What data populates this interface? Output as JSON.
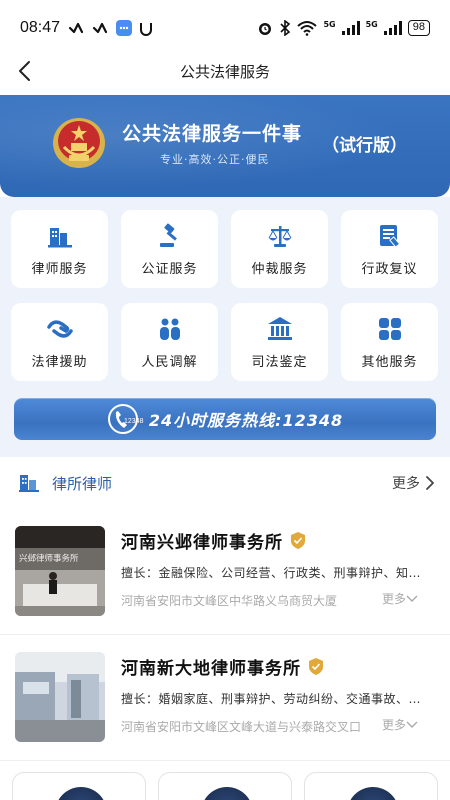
{
  "status_bar": {
    "time": "08:47",
    "network_1": "5G",
    "network_2": "5G",
    "battery": "98"
  },
  "nav": {
    "title": "公共法律服务"
  },
  "banner": {
    "title": "公共法律服务一件事",
    "tag": "（试行版）",
    "subtitle": "专业·高效·公正·便民"
  },
  "services": [
    {
      "label": "律师服务",
      "icon": "building-icon"
    },
    {
      "label": "公证服务",
      "icon": "gavel-icon"
    },
    {
      "label": "仲裁服务",
      "icon": "scales-icon"
    },
    {
      "label": "行政复议",
      "icon": "document-icon"
    },
    {
      "label": "法律援助",
      "icon": "handshake-icon"
    },
    {
      "label": "人民调解",
      "icon": "people-icon"
    },
    {
      "label": "司法鉴定",
      "icon": "courthouse-icon"
    },
    {
      "label": "其他服务",
      "icon": "grid-icon"
    }
  ],
  "hotline": {
    "badge": "12348",
    "text": "24小时服务热线:12348"
  },
  "section": {
    "title": "律所律师",
    "more": "更多"
  },
  "firms": [
    {
      "name": "河南兴邺律师事务所",
      "specialty": "擅长：金融保险、公司经营、行政类、刑事辩护、知识产权",
      "address": "河南省安阳市文峰区中华路义乌商贸大厦",
      "more": "更多",
      "photo_sign": "兴邺律师事务所"
    },
    {
      "name": "河南新大地律师事务所",
      "specialty": "擅长：婚姻家庭、刑事辩护、劳动纠纷、交通事故、合同纠纷",
      "address": "河南省安阳市文峰区文峰大道与兴泰路交叉口",
      "more": "更多"
    }
  ],
  "colors": {
    "primary": "#3a75c2",
    "accent_title": "#2b5fa6",
    "page_bg": "#eef3fb",
    "badge_gold": "#e0a93a"
  }
}
